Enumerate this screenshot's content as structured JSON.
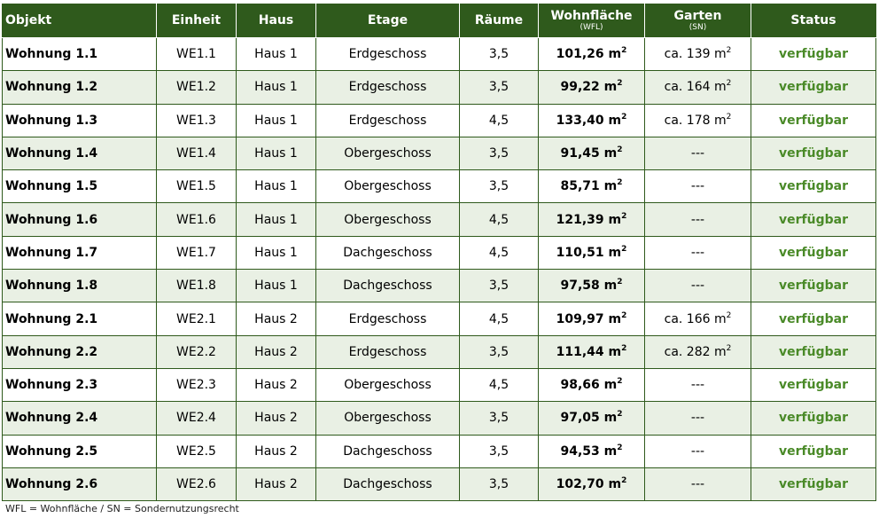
{
  "table": {
    "headers": {
      "objekt": "Objekt",
      "einheit": "Einheit",
      "haus": "Haus",
      "etage": "Etage",
      "raeume": "Räume",
      "wohnflaeche": "Wohnfläche",
      "wohnflaeche_sub": "(WFL)",
      "garten": "Garten",
      "garten_sub": "(SN)",
      "status": "Status"
    },
    "unit_sup": "2",
    "rows": [
      {
        "objekt": "Wohnung 1.1",
        "einheit": "WE1.1",
        "haus": "Haus 1",
        "etage": "Erdgeschoss",
        "raeume": "3,5",
        "wfl": "101,26 m",
        "garten": "ca. 139 m",
        "garten_sup": "2",
        "status": "verfügbar"
      },
      {
        "objekt": "Wohnung 1.2",
        "einheit": "WE1.2",
        "haus": "Haus 1",
        "etage": "Erdgeschoss",
        "raeume": "3,5",
        "wfl": "99,22 m",
        "garten": "ca. 164 m",
        "garten_sup": "2",
        "status": "verfügbar"
      },
      {
        "objekt": "Wohnung 1.3",
        "einheit": "WE1.3",
        "haus": "Haus 1",
        "etage": "Erdgeschoss",
        "raeume": "4,5",
        "wfl": "133,40 m",
        "garten": "ca. 178 m",
        "garten_sup": "2",
        "status": "verfügbar"
      },
      {
        "objekt": "Wohnung 1.4",
        "einheit": "WE1.4",
        "haus": "Haus 1",
        "etage": "Obergeschoss",
        "raeume": "3,5",
        "wfl": "91,45 m",
        "garten": "---",
        "garten_sup": "",
        "status": "verfügbar"
      },
      {
        "objekt": "Wohnung 1.5",
        "einheit": "WE1.5",
        "haus": "Haus 1",
        "etage": "Obergeschoss",
        "raeume": "3,5",
        "wfl": "85,71 m",
        "garten": "---",
        "garten_sup": "",
        "status": "verfügbar"
      },
      {
        "objekt": "Wohnung 1.6",
        "einheit": "WE1.6",
        "haus": "Haus 1",
        "etage": "Obergeschoss",
        "raeume": "4,5",
        "wfl": "121,39 m",
        "garten": "---",
        "garten_sup": "",
        "status": "verfügbar"
      },
      {
        "objekt": "Wohnung 1.7",
        "einheit": "WE1.7",
        "haus": "Haus 1",
        "etage": "Dachgeschoss",
        "raeume": "4,5",
        "wfl": "110,51 m",
        "garten": "---",
        "garten_sup": "",
        "status": "verfügbar"
      },
      {
        "objekt": "Wohnung 1.8",
        "einheit": "WE1.8",
        "haus": "Haus 1",
        "etage": "Dachgeschoss",
        "raeume": "3,5",
        "wfl": "97,58 m",
        "garten": "---",
        "garten_sup": "",
        "status": "verfügbar"
      },
      {
        "objekt": "Wohnung 2.1",
        "einheit": "WE2.1",
        "haus": "Haus 2",
        "etage": "Erdgeschoss",
        "raeume": "4,5",
        "wfl": "109,97 m",
        "garten": "ca. 166 m",
        "garten_sup": "2",
        "status": "verfügbar"
      },
      {
        "objekt": "Wohnung 2.2",
        "einheit": "WE2.2",
        "haus": "Haus 2",
        "etage": "Erdgeschoss",
        "raeume": "3,5",
        "wfl": "111,44 m",
        "garten": "ca. 282 m",
        "garten_sup": "2",
        "status": "verfügbar"
      },
      {
        "objekt": "Wohnung 2.3",
        "einheit": "WE2.3",
        "haus": "Haus 2",
        "etage": "Obergeschoss",
        "raeume": "4,5",
        "wfl": "98,66 m",
        "garten": "---",
        "garten_sup": "",
        "status": "verfügbar"
      },
      {
        "objekt": "Wohnung 2.4",
        "einheit": "WE2.4",
        "haus": "Haus 2",
        "etage": "Obergeschoss",
        "raeume": "3,5",
        "wfl": "97,05 m",
        "garten": "---",
        "garten_sup": "",
        "status": "verfügbar"
      },
      {
        "objekt": "Wohnung 2.5",
        "einheit": "WE2.5",
        "haus": "Haus 2",
        "etage": "Dachgeschoss",
        "raeume": "3,5",
        "wfl": "94,53 m",
        "garten": "---",
        "garten_sup": "",
        "status": "verfügbar"
      },
      {
        "objekt": "Wohnung 2.6",
        "einheit": "WE2.6",
        "haus": "Haus 2",
        "etage": "Dachgeschoss",
        "raeume": "3,5",
        "wfl": "102,70 m",
        "garten": "---",
        "garten_sup": "",
        "status": "verfügbar"
      }
    ]
  },
  "footnote": "WFL = Wohnfläche / SN = Sondernutzungsrecht",
  "colors": {
    "header_bg": "#2f5a1c",
    "status_text": "#4a8a28",
    "alt_row_bg": "#e9f0e4"
  }
}
